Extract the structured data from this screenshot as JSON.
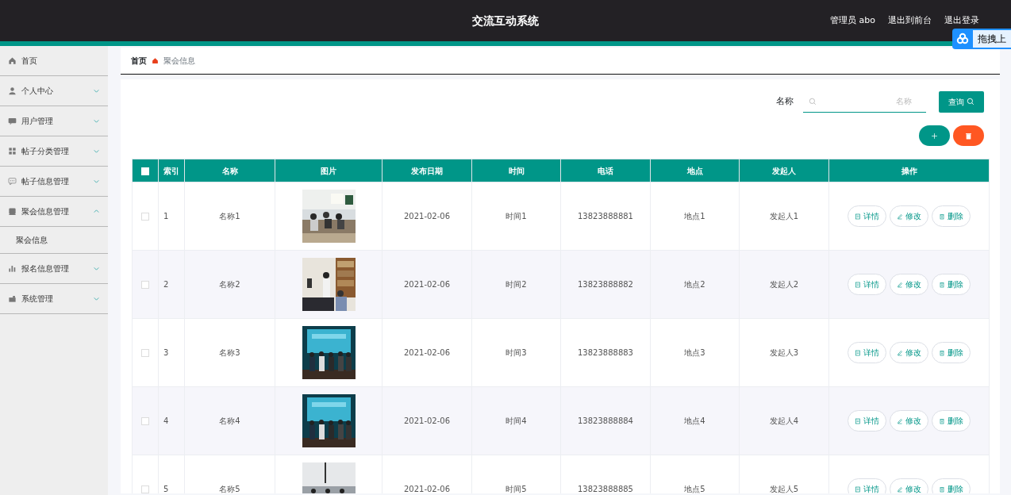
{
  "header": {
    "title": "交流互动系统",
    "user": "管理员 abo",
    "links": [
      "退出到前台",
      "退出登录"
    ]
  },
  "upload_widget": {
    "label": "拖拽上"
  },
  "sidebar": {
    "items": [
      {
        "label": "首页",
        "kind": "link"
      },
      {
        "label": "个人中心",
        "kind": "menu",
        "expanded": false
      },
      {
        "label": "用户管理",
        "kind": "menu",
        "expanded": false
      },
      {
        "label": "帖子分类管理",
        "kind": "menu",
        "expanded": false
      },
      {
        "label": "帖子信息管理",
        "kind": "menu",
        "expanded": false
      },
      {
        "label": "聚会信息管理",
        "kind": "menu",
        "expanded": true,
        "children": [
          {
            "label": "聚会信息"
          }
        ]
      },
      {
        "label": "报名信息管理",
        "kind": "menu",
        "expanded": false
      },
      {
        "label": "系统管理",
        "kind": "menu",
        "expanded": false
      }
    ]
  },
  "breadcrumb": [
    "首页",
    "聚会信息"
  ],
  "search": {
    "label": "名称",
    "placeholder": "名称",
    "button": "查询"
  },
  "table": {
    "select_all": {
      "checked": false
    },
    "columns": [
      "索引",
      "名称",
      "图片",
      "发布日期",
      "时间",
      "电话",
      "地点",
      "发起人",
      "操作"
    ],
    "rows": [
      {
        "checked": false,
        "index": "1",
        "name": "名称1",
        "date": "2021-02-06",
        "time": "时间1",
        "phone": "13823888881",
        "place": "地点1",
        "initiator": "发起人1",
        "actions": [
          "详情",
          "修改",
          "删除"
        ]
      },
      {
        "checked": false,
        "index": "2",
        "name": "名称2",
        "date": "2021-02-06",
        "time": "时间2",
        "phone": "13823888882",
        "place": "地点2",
        "initiator": "发起人2",
        "actions": [
          "详情",
          "修改",
          "删除"
        ]
      },
      {
        "checked": false,
        "index": "3",
        "name": "名称3",
        "date": "2021-02-06",
        "time": "时间3",
        "phone": "13823888883",
        "place": "地点3",
        "initiator": "发起人3",
        "actions": [
          "详情",
          "修改",
          "删除"
        ]
      },
      {
        "checked": false,
        "index": "4",
        "name": "名称4",
        "date": "2021-02-06",
        "time": "时间4",
        "phone": "13823888884",
        "place": "地点4",
        "initiator": "发起人4",
        "actions": [
          "详情",
          "修改",
          "删除"
        ]
      },
      {
        "checked": false,
        "index": "5",
        "name": "名称5",
        "date": "2021-02-06",
        "time": "时间5",
        "phone": "13823888885",
        "place": "地点5",
        "initiator": "发起人5",
        "actions": [
          "详情",
          "修改",
          "删除"
        ]
      }
    ]
  }
}
